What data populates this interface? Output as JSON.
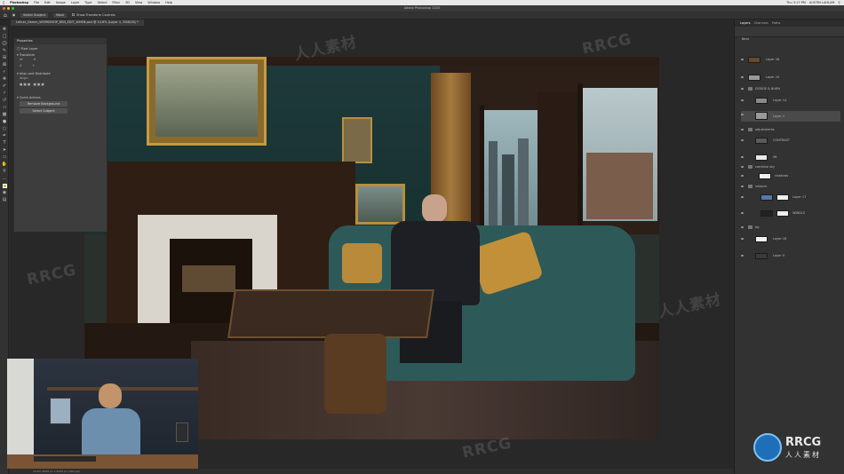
{
  "menubar": {
    "app": "Photoshop",
    "items": [
      "File",
      "Edit",
      "Image",
      "Layer",
      "Type",
      "Select",
      "Filter",
      "3D",
      "View",
      "Window",
      "Help"
    ],
    "clock": "Thu 3:17 PM",
    "user": "AUSTIN LAHLUM"
  },
  "titlebar": {
    "title": "Adobe Photoshop 2020"
  },
  "options": {
    "select_subject": "Select Subject",
    "mask_label": "Mask",
    "show_transform": "Show Transform Controls"
  },
  "document": {
    "tab": "Lehrer_Hamm_WORKSHOP_KEN_EDIT_WHEN.psd @ 14.6% (Layer 1, RGB/16) *"
  },
  "properties": {
    "title": "Properties",
    "pixel_layer": "Pixel Layer",
    "transform": "Transform",
    "align": "Align and Distribute",
    "align_sub": "Align:",
    "quick_actions": "Quick Actions",
    "remove_bg": "Remove Background",
    "select_subject": "Select Subject"
  },
  "panel": {
    "tabs": [
      "Layers",
      "Channels",
      "Paths"
    ],
    "kind": "Kind",
    "layers": [
      {
        "name": "Layer 18"
      },
      {
        "name": "Layer 19"
      },
      {
        "name": "DODGE & BURN"
      },
      {
        "name": "Layer 14"
      },
      {
        "name": "Layer 1"
      },
      {
        "name": "adjustments"
      },
      {
        "name": "CONTRAST"
      },
      {
        "name": "lift"
      },
      {
        "name": "combine sky"
      },
      {
        "name": "shadows"
      },
      {
        "name": "retouch"
      },
      {
        "name": "Layer 17"
      },
      {
        "name": "WINDLS"
      },
      {
        "name": "bg"
      },
      {
        "name": "Layer 16"
      },
      {
        "name": "Layer 0"
      }
    ]
  },
  "status": {
    "text": "14.6%   6000 px x 4000 px (300 ppi)"
  },
  "watermark": {
    "text_cn": "人人素材",
    "text_en": "RRCG"
  },
  "colors": {
    "accent": "#1f6fb8",
    "panel": "#323232",
    "canvas_bg": "#282828"
  }
}
